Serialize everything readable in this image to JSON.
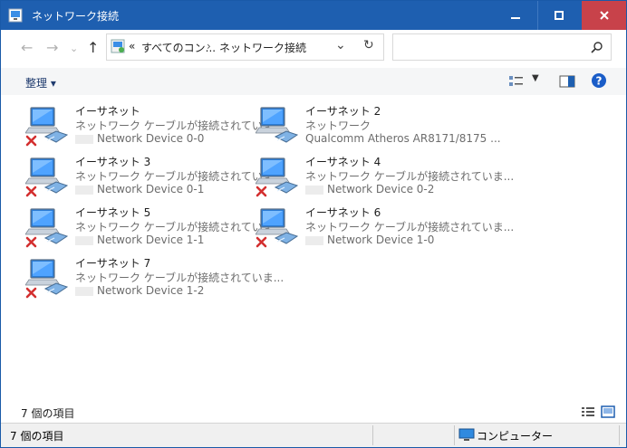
{
  "window": {
    "title": "ネットワーク接続",
    "controls": {
      "minimize": "−",
      "maximize": "□",
      "close": "✕"
    }
  },
  "nav": {
    "breadcrumb_overflow": "«",
    "breadcrumb_1": "すべてのコン...",
    "breadcrumb_sep": "›",
    "breadcrumb_2": "ネットワーク接続",
    "search_placeholder": ""
  },
  "command_bar": {
    "organize_label": "整理 ▾"
  },
  "connections": [
    {
      "name": "イーサネット",
      "status": "ネットワーク ケーブルが接続されていま...",
      "device": "Network Device 0-0",
      "disconnected": true,
      "blurred": true
    },
    {
      "name": "イーサネット 2",
      "status": "ネットワーク",
      "device": "Qualcomm Atheros AR8171/8175 ...",
      "disconnected": false,
      "blurred": false
    },
    {
      "name": "イーサネット 3",
      "status": "ネットワーク ケーブルが接続されていま...",
      "device": "Network Device 0-1",
      "disconnected": true,
      "blurred": true
    },
    {
      "name": "イーサネット 4",
      "status": "ネットワーク ケーブルが接続されていま...",
      "device": "Network Device 0-2",
      "disconnected": true,
      "blurred": true
    },
    {
      "name": "イーサネット 5",
      "status": "ネットワーク ケーブルが接続されていま...",
      "device": "Network Device 1-1",
      "disconnected": true,
      "blurred": true
    },
    {
      "name": "イーサネット 6",
      "status": "ネットワーク ケーブルが接続されていま...",
      "device": "Network Device 1-0",
      "disconnected": true,
      "blurred": true
    },
    {
      "name": "イーサネット 7",
      "status": "ネットワーク ケーブルが接続されていま...",
      "device": "Network Device 1-2",
      "disconnected": true,
      "blurred": true
    }
  ],
  "status": {
    "item_count": "7 個の項目",
    "bottom_item_count": "7 個の項目",
    "computer_label": "コンピューター"
  },
  "colors": {
    "titlebar": "#1e5fb0",
    "close_button": "#c8424a",
    "help_icon": "#1a5dc8",
    "disconnected_x": "#d32f2f"
  },
  "icons": {
    "app": "network-connections-icon",
    "back": "back-arrow-icon",
    "forward": "forward-arrow-icon",
    "up": "up-arrow-icon",
    "dropdown": "chevron-down-icon",
    "refresh": "refresh-icon",
    "search": "search-icon",
    "view_options": "view-options-icon",
    "preview_pane": "preview-pane-icon",
    "help": "help-icon",
    "details_view": "details-view-icon",
    "large_icons_view": "large-icons-view-icon",
    "computer": "computer-icon"
  }
}
